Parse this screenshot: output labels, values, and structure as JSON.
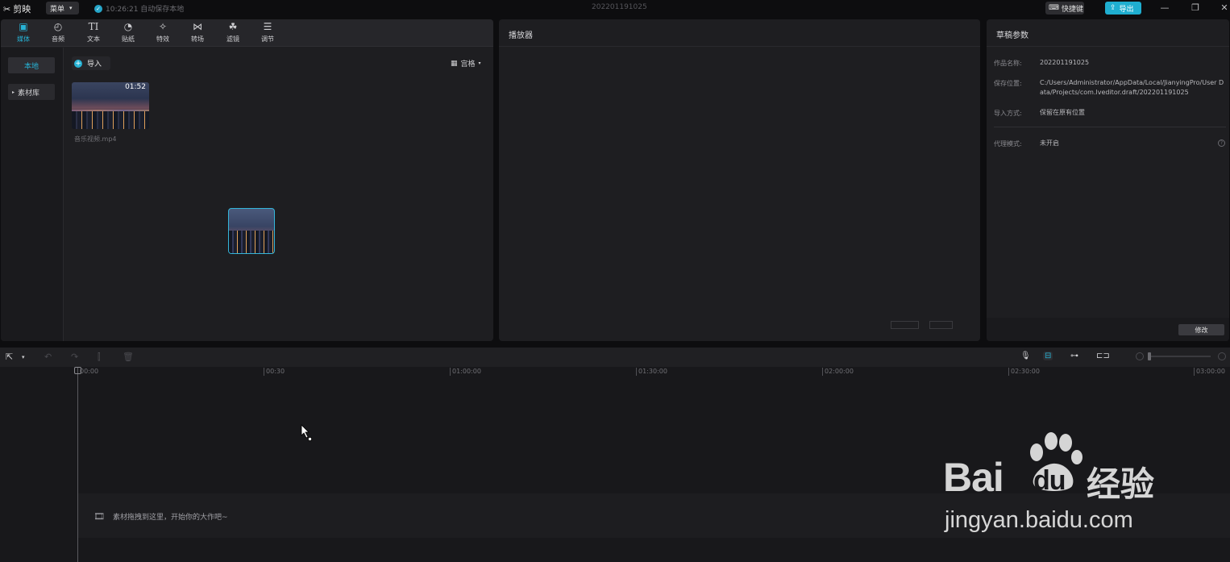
{
  "titlebar": {
    "app_name": "剪映",
    "menu_label": "菜单",
    "autosave_text": "10:26:21 自动保存本地",
    "project_title": "202201191025",
    "shortcut_label": "快捷键",
    "export_label": "导出"
  },
  "tool_tabs": [
    {
      "label": "媒体",
      "icon": "media-icon"
    },
    {
      "label": "音频",
      "icon": "audio-icon"
    },
    {
      "label": "文本",
      "icon": "text-icon"
    },
    {
      "label": "贴纸",
      "icon": "sticker-icon"
    },
    {
      "label": "特效",
      "icon": "effects-icon"
    },
    {
      "label": "转场",
      "icon": "transition-icon"
    },
    {
      "label": "滤镜",
      "icon": "filter-icon"
    },
    {
      "label": "调节",
      "icon": "adjust-icon"
    }
  ],
  "sidebar": {
    "local_label": "本地",
    "library_label": "素材库"
  },
  "media": {
    "import_label": "导入",
    "view_label": "宫格",
    "clip_duration": "01:52",
    "clip_name": "音乐视频.mp4"
  },
  "player": {
    "title": "播放器"
  },
  "draft": {
    "title": "草稿参数",
    "name_label": "作品名称:",
    "name_value": "202201191025",
    "path_label": "保存位置:",
    "path_value": "C:/Users/Administrator/AppData/Local/JianyingPro/User Data/Projects/com.lveditor.draft/202201191025",
    "import_label": "导入方式:",
    "import_value": "保留在原有位置",
    "proxy_label": "代理模式:",
    "proxy_value": "未开启",
    "modify_label": "修改"
  },
  "timeline": {
    "ticks": [
      "00:00",
      "00:30",
      "01:00:00",
      "01:30:00",
      "02:00:00",
      "02:30:00",
      "03:00:00"
    ],
    "drop_hint": "素材拖拽到这里，开始你的大作吧~"
  },
  "watermark": {
    "brand": "Bai",
    "brand_tail": "du",
    "brand_cn": "经验",
    "url": "jingyan.baidu.com"
  },
  "colors": {
    "accent": "#27b3d6",
    "export_bg": "#1faed0",
    "panel_bg": "#1e1e21",
    "app_bg": "#0d0d0f"
  }
}
